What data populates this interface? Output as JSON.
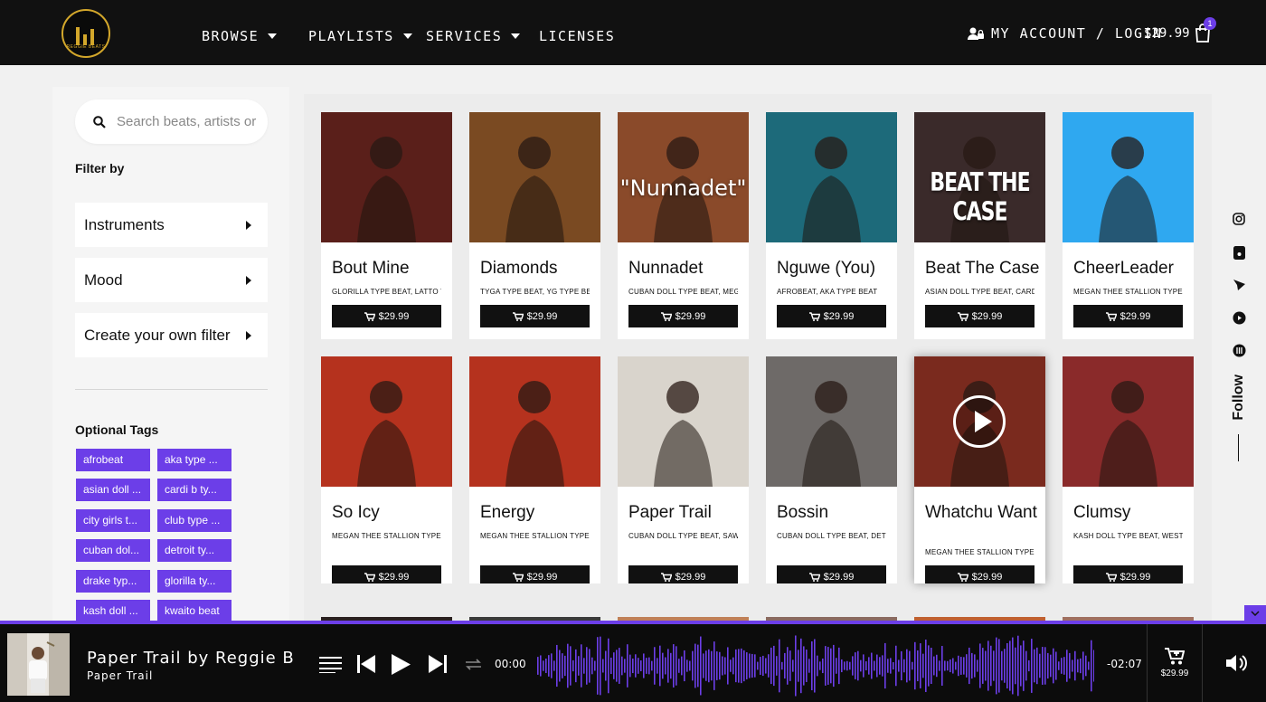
{
  "header": {
    "logo_text": "REGGIE BEATS",
    "nav": [
      {
        "label": "BROWSE",
        "dropdown": true
      },
      {
        "label": "PLAYLISTS",
        "dropdown": true
      },
      {
        "label": "SERVICES",
        "dropdown": true
      },
      {
        "label": "LICENSES",
        "dropdown": false
      }
    ],
    "account_label": "MY ACCOUNT / LOGIN",
    "cart_total": "$29.99",
    "cart_count": "1"
  },
  "sidebar": {
    "search_placeholder": "Search beats, artists or",
    "filter_by": "Filter by",
    "filters": [
      "Instruments",
      "Mood",
      "Create your own filter"
    ],
    "tags_title": "Optional Tags",
    "tags": [
      "afrobeat",
      "aka type ...",
      "asian doll ...",
      "cardi b ty...",
      "city girls t...",
      "club type ...",
      "cuban dol...",
      "detroit ty...",
      "drake typ...",
      "glorilla ty...",
      "kash doll ...",
      "kwaito beat"
    ]
  },
  "beats": [
    {
      "title": "Bout Mine",
      "tags": "GLORILLA TYPE BEAT, LATTO TYPE BEAT",
      "price": "$29.99",
      "thumb_color": "#5a1f1a",
      "overlay": ""
    },
    {
      "title": "Diamonds",
      "tags": "TYGA TYPE BEAT, YG TYPE BEAT",
      "price": "$29.99",
      "thumb_color": "#7a4a22",
      "overlay": ""
    },
    {
      "title": "Nunnadet",
      "tags": "CUBAN DOLL TYPE BEAT, MEGAN",
      "price": "$29.99",
      "thumb_color": "#8a4a2a",
      "overlay": "\"Nunnadet\""
    },
    {
      "title": "Nguwe (You)",
      "tags": "AFROBEAT, AKA TYPE BEAT",
      "price": "$29.99",
      "thumb_color": "#1d6a7a",
      "overlay": ""
    },
    {
      "title": "Beat The Case",
      "tags": "ASIAN DOLL TYPE BEAT, CARDI",
      "price": "$29.99",
      "thumb_color": "#3a2a2a",
      "overlay": "BEAT THE CASE"
    },
    {
      "title": "CheerLeader",
      "tags": "MEGAN THEE STALLION TYPE BEAT",
      "price": "$29.99",
      "thumb_color": "#2fa8f0",
      "overlay": ""
    },
    {
      "title": "So Icy",
      "tags": "MEGAN THEE STALLION TYPE BEAT",
      "price": "$29.99",
      "thumb_color": "#b5321e",
      "overlay": ""
    },
    {
      "title": "Energy",
      "tags": "MEGAN THEE STALLION TYPE BEAT",
      "price": "$29.99",
      "thumb_color": "#b5321e",
      "overlay": ""
    },
    {
      "title": "Paper Trail",
      "tags": "CUBAN DOLL TYPE BEAT, SAWEETIE",
      "price": "$29.99",
      "thumb_color": "#d9d4cc",
      "overlay": ""
    },
    {
      "title": "Bossin",
      "tags": "CUBAN DOLL TYPE BEAT, DETROIT",
      "price": "$29.99",
      "thumb_color": "#6e6a68",
      "overlay": ""
    },
    {
      "title": "Whatchu Want",
      "tags": "MEGAN THEE STALLION TYPE BEAT",
      "price": "$29.99",
      "thumb_color": "#7a2a1e",
      "overlay": ""
    },
    {
      "title": "Clumsy",
      "tags": "KASH DOLL TYPE BEAT, WESTSIDE",
      "price": "$29.99",
      "thumb_color": "#8a2a2a",
      "overlay": ""
    }
  ],
  "social": {
    "icons": [
      "instagram-icon",
      "tiktok-icon",
      "soundcloud-icon",
      "youtube-icon",
      "beatstars-icon"
    ],
    "follow_label": "Follow"
  },
  "player": {
    "track_title": "Paper Trail by Reggie B",
    "track_sub": "Paper Trail",
    "elapsed": "00:00",
    "remaining": "-02:07",
    "price": "$29.99",
    "accent": "#6c3ee8"
  }
}
